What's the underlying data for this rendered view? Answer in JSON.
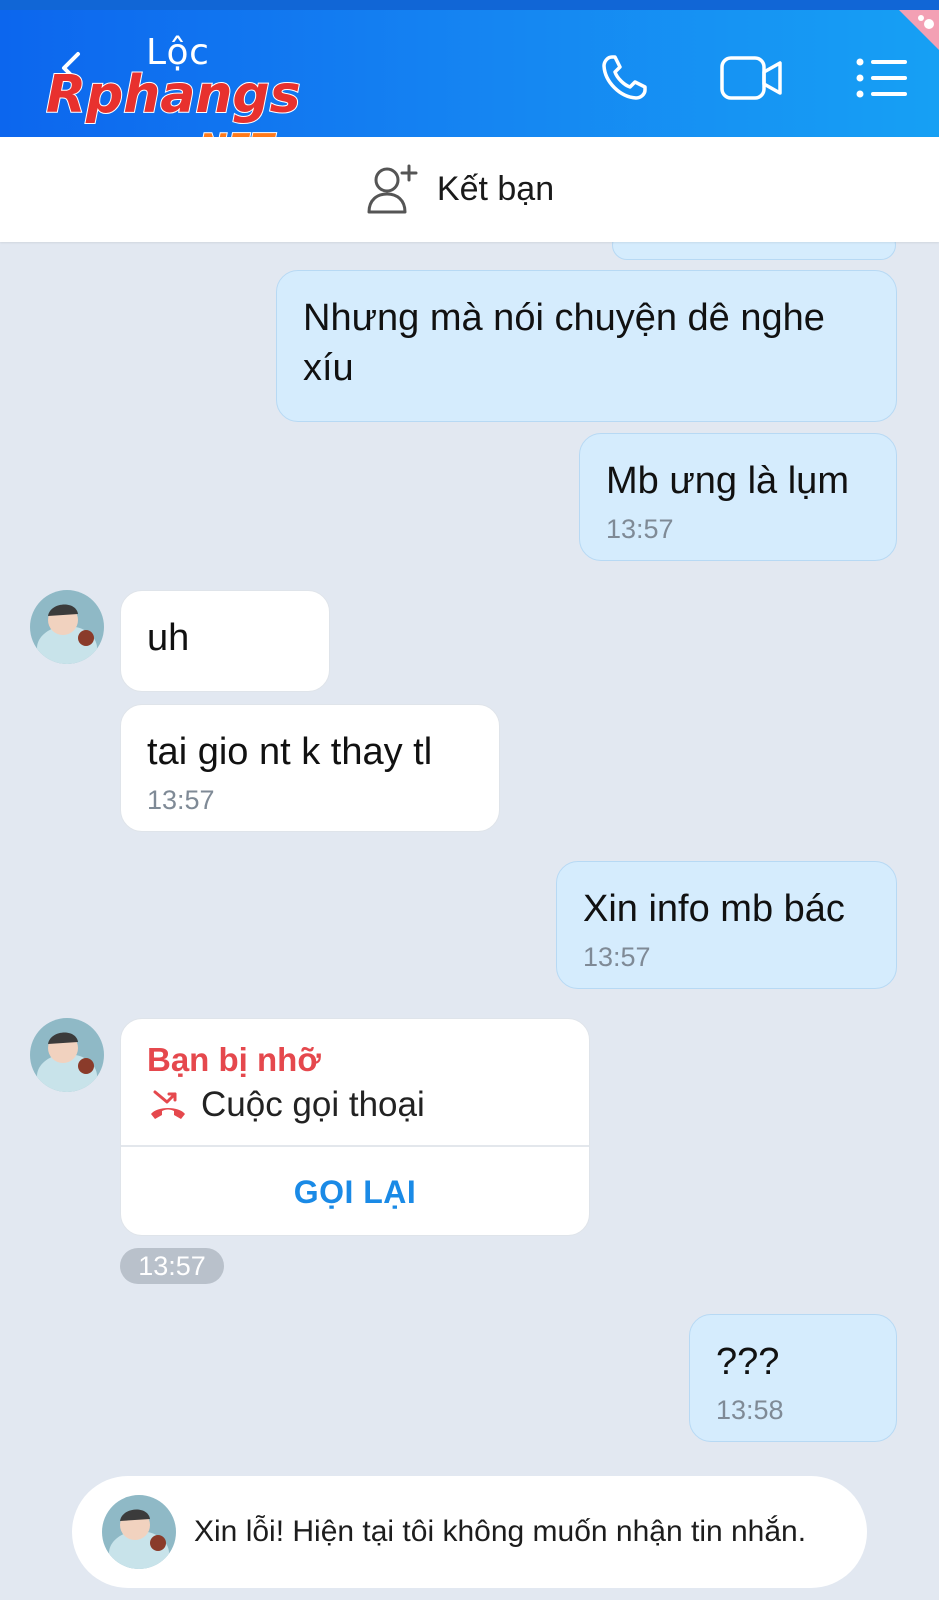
{
  "header": {
    "contact_name": "Lộc",
    "watermark_text": "Rphangs",
    "watermark_domain": ".NET",
    "back_icon": "back-arrow-icon",
    "call_icon": "phone-icon",
    "video_icon": "video-camera-icon",
    "menu_icon": "list-menu-icon",
    "colors": {
      "start": "#0c66ee",
      "end": "#16a0f4"
    }
  },
  "friend_bar": {
    "label": "Kết bạn",
    "icon": "add-friend-icon"
  },
  "messages": [
    {
      "from": "me",
      "text": "Nhưng mà nói chuyện dê nghe xíu"
    },
    {
      "from": "me",
      "text": "Mb ưng là lụm",
      "time": "13:57"
    },
    {
      "from": "them",
      "text": "uh"
    },
    {
      "from": "them",
      "text": "tai gio nt k thay tl",
      "time": "13:57"
    },
    {
      "from": "me",
      "text": "Xin info mb bác",
      "time": "13:57"
    },
    {
      "from": "me",
      "text": "???",
      "time": "13:58"
    }
  ],
  "missed_call": {
    "title": "Bạn bị nhỡ",
    "description": "Cuộc gọi thoại",
    "action": "GỌI LẠI",
    "time": "13:57",
    "icon": "missed-call-icon"
  },
  "notice": {
    "text": "Xin lỗi! Hiện tại tôi không muốn nhận tin nhắn."
  },
  "colors": {
    "background": "#e2e8f1",
    "my_bubble": "#d5ecfd",
    "their_bubble": "#ffffff",
    "missed_red": "#e5484d",
    "callback_blue": "#1a8ae6"
  }
}
